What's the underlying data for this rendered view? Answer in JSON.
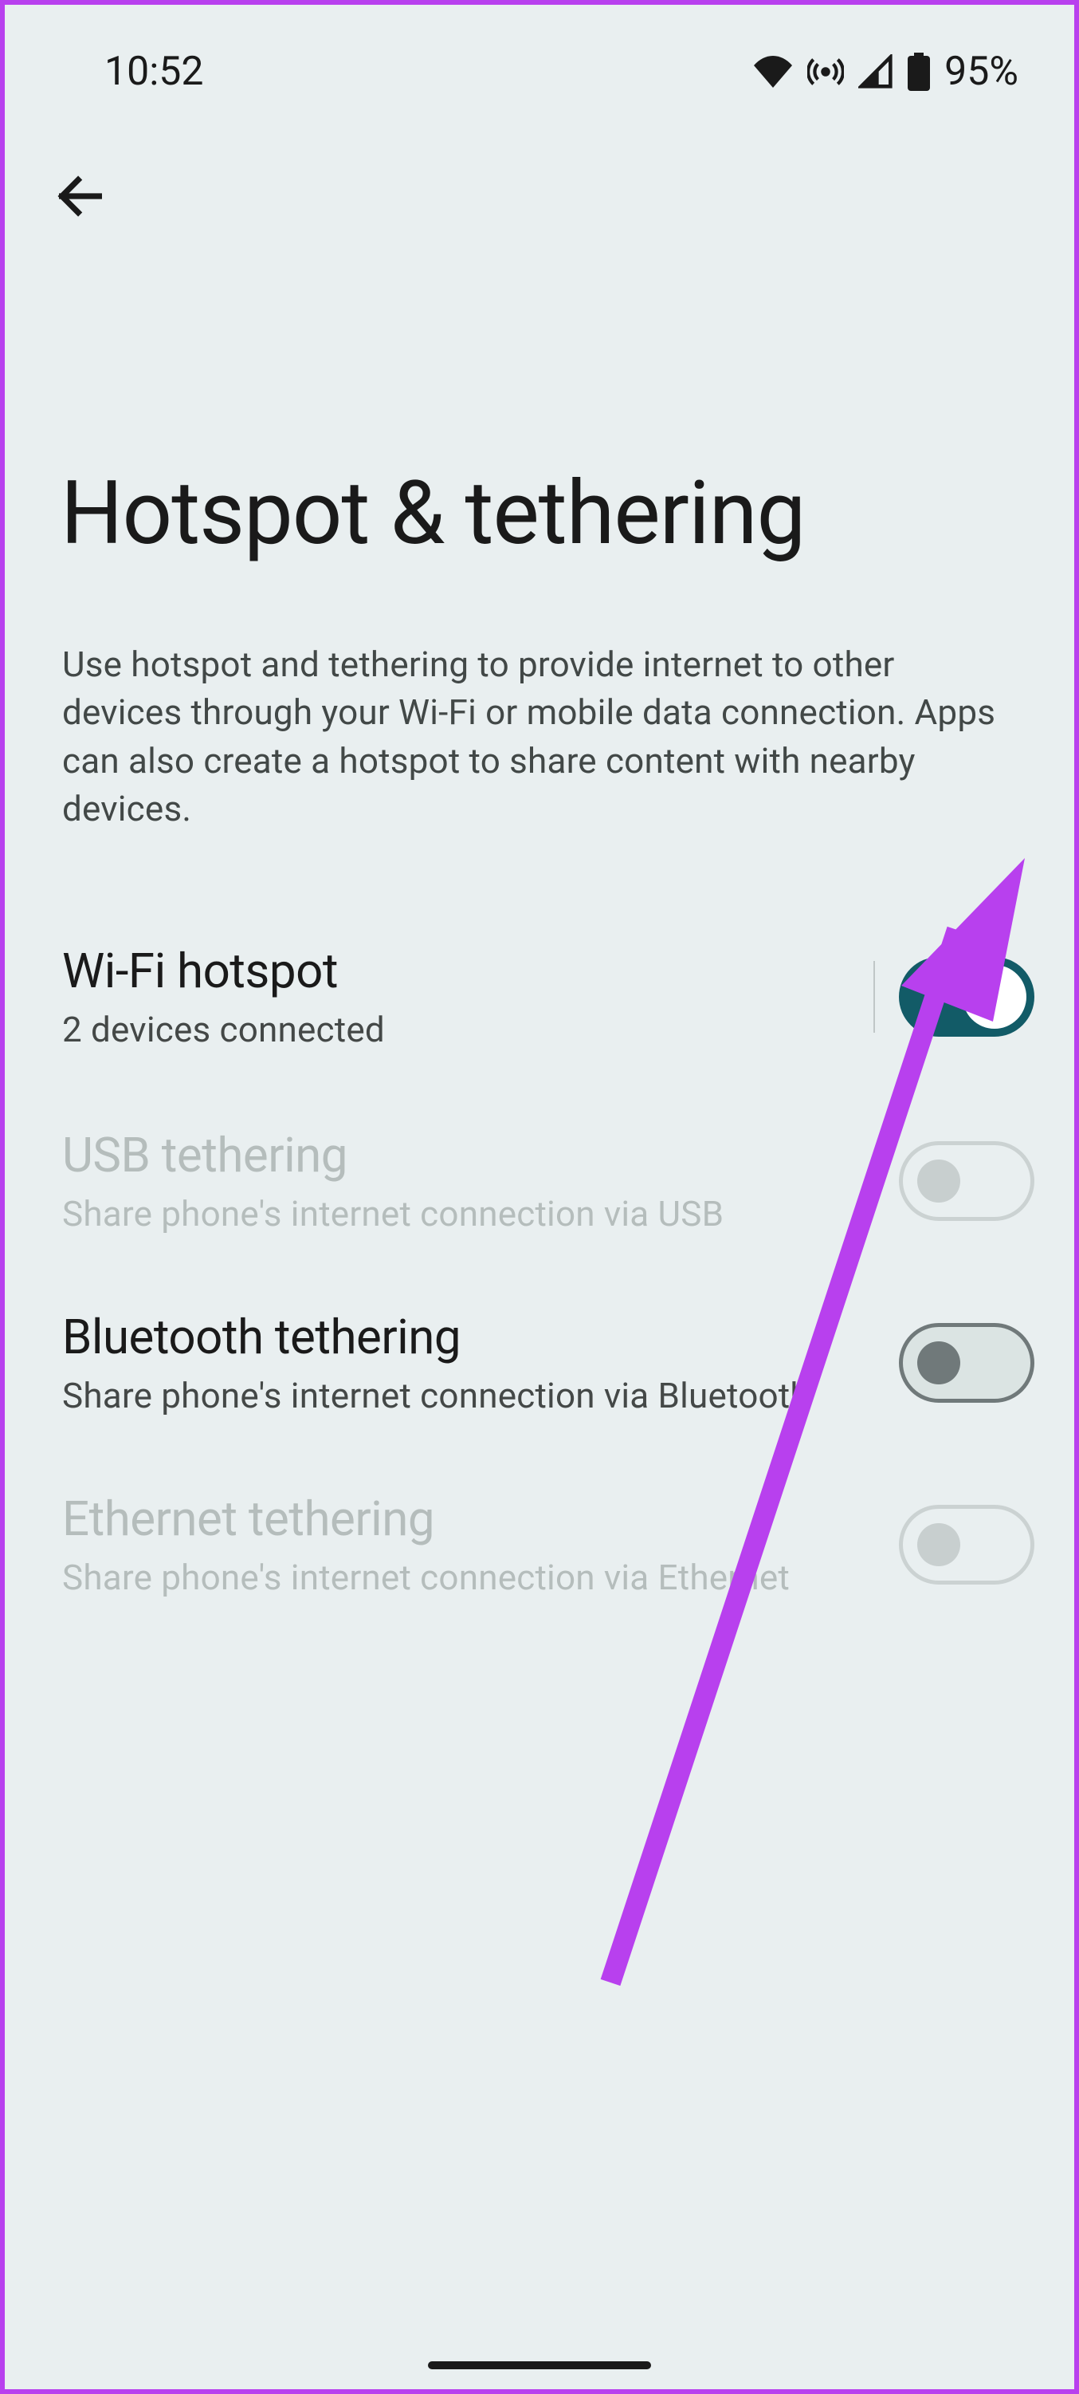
{
  "status_bar": {
    "time": "10:52",
    "battery_pct": "95%"
  },
  "page": {
    "title": "Hotspot & tethering",
    "description": "Use hotspot and tethering to provide internet to other devices through your Wi-Fi or mobile data connection. Apps can also create a hotspot to share content with nearby devices."
  },
  "settings": [
    {
      "title": "Wi-Fi hotspot",
      "subtitle": "2 devices connected",
      "toggle_on": true,
      "disabled": false,
      "has_divider": true
    },
    {
      "title": "USB tethering",
      "subtitle": "Share phone's internet connection via USB",
      "toggle_on": false,
      "disabled": true,
      "has_divider": false
    },
    {
      "title": "Bluetooth tethering",
      "subtitle": "Share phone's internet connection via Bluetooth",
      "toggle_on": false,
      "disabled": false,
      "has_divider": false
    },
    {
      "title": "Ethernet tethering",
      "subtitle": "Share phone's internet connection via Ethernet",
      "toggle_on": false,
      "disabled": true,
      "has_divider": false
    }
  ],
  "annotation": {
    "color": "#b840ee"
  }
}
